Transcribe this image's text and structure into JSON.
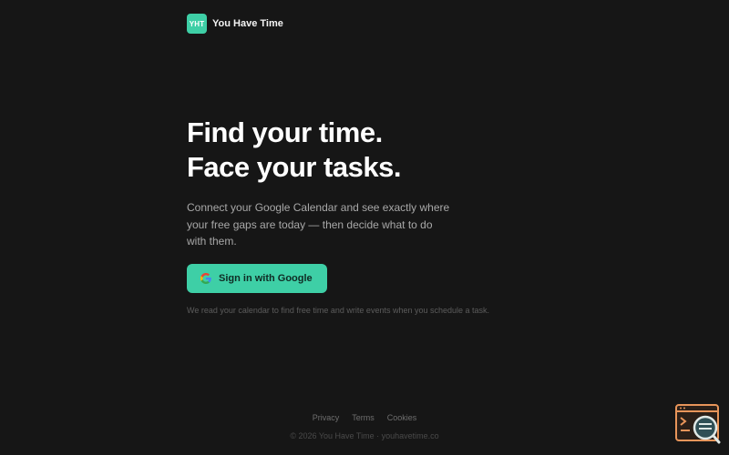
{
  "brand": {
    "logo_text": "YHT",
    "name": "You Have Time",
    "accent_color": "#3ecfa6"
  },
  "hero": {
    "headline_line1": "Find your time.",
    "headline_line2": "Face your tasks.",
    "description": "Connect your Google Calendar and see exactly where your free gaps are today — then decide what to do with them.",
    "signin_label": "Sign in with Google",
    "signin_icon": "google-icon",
    "disclaimer": "We read your calendar to find free time and write events when you schedule a task."
  },
  "footer": {
    "links": [
      "Privacy",
      "Terms",
      "Cookies"
    ],
    "copyright": "© 2026 You Have Time · youhavetime.co"
  },
  "widget": {
    "icon": "terminal-search-icon",
    "colors": {
      "frame": "#e8955a",
      "lens": "#2f4f55"
    }
  }
}
